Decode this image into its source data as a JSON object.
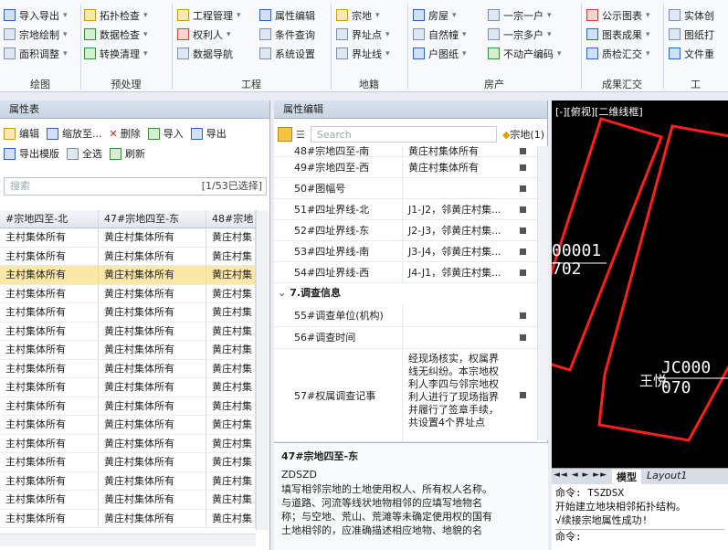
{
  "ribbon": {
    "col1": [
      "导入导出",
      "宗地绘制",
      "面积调整"
    ],
    "col2": [
      "拓扑检查",
      "数据检查",
      "转换清理"
    ],
    "col3": [
      "工程管理",
      "权利人",
      "数据导航"
    ],
    "col4": [
      "属性编辑",
      "条件查询",
      "系统设置"
    ],
    "col5": [
      "宗地",
      "界址点",
      "界址线"
    ],
    "col6": [
      "房屋",
      "自然幢",
      "户图纸"
    ],
    "col7": [
      "一宗一户",
      "一宗多户",
      "不动产编码"
    ],
    "col8": [
      "公示图表",
      "图表成果",
      "质检汇交"
    ],
    "col9": [
      "实体创",
      "图纸打",
      "文件重"
    ],
    "groups": [
      "绘图",
      "预处理",
      "工程",
      "地籍",
      "房产",
      "成果汇交",
      "工"
    ]
  },
  "attr_table": {
    "title": "属性表",
    "toolbar1": [
      "编辑",
      "缩放至...",
      "删除",
      "导入",
      "导出"
    ],
    "toolbar2": [
      "导出模版",
      "全选",
      "刷新"
    ],
    "search_placeholder": "搜索",
    "selection_count": "[1/53已选择]",
    "columns": [
      "#宗地四至-北",
      "47#宗地四至-东",
      "48#宗地"
    ],
    "rows": [
      [
        "主村集体所有",
        "黄庄村集体所有",
        "黄庄村集"
      ],
      [
        "主村集体所有",
        "黄庄村集体所有",
        "黄庄村集"
      ],
      [
        "主村集体所有",
        "黄庄村集体所有",
        "黄庄村集"
      ],
      [
        "主村集体所有",
        "黄庄村集体所有",
        "黄庄村集"
      ],
      [
        "主村集体所有",
        "黄庄村集体所有",
        "黄庄村集"
      ],
      [
        "主村集体所有",
        "黄庄村集体所有",
        "黄庄村集"
      ],
      [
        "主村集体所有",
        "黄庄村集体所有",
        "黄庄村集"
      ],
      [
        "主村集体所有",
        "黄庄村集体所有",
        "黄庄村集"
      ],
      [
        "主村集体所有",
        "黄庄村集体所有",
        "黄庄村集"
      ],
      [
        "主村集体所有",
        "黄庄村集体所有",
        "黄庄村集"
      ],
      [
        "主村集体所有",
        "黄庄村集体所有",
        "黄庄村集"
      ],
      [
        "主村集体所有",
        "黄庄村集体所有",
        "黄庄村集"
      ],
      [
        "主村集体所有",
        "黄庄村集体所有",
        "黄庄村集"
      ],
      [
        "主村集体所有",
        "黄庄村集体所有",
        "黄庄村集"
      ],
      [
        "主村集体所有",
        "黄庄村集体所有",
        "黄庄村集"
      ],
      [
        "主村集体所有",
        "黄庄村集体所有",
        "黄庄村集"
      ]
    ],
    "selected_row_index": 2
  },
  "attr_edit": {
    "title": "属性编辑",
    "search_placeholder": "Search",
    "layer": "宗地(1)",
    "props": [
      [
        "48#宗地四至-南",
        "黄庄村集体所有"
      ],
      [
        "49#宗地四至-西",
        "黄庄村集体所有"
      ],
      [
        "50#图幅号",
        ""
      ],
      [
        "51#四址界线-北",
        "J1-J2，邻黄庄村集..."
      ],
      [
        "52#四址界线-东",
        "J2-J3，邻黄庄村集..."
      ],
      [
        "53#四址界线-南",
        "J3-J4，邻黄庄村集..."
      ],
      [
        "54#四址界线-西",
        "J4-J1，邻黄庄村集..."
      ]
    ],
    "section": "7.调查信息",
    "props2": [
      [
        "55#调查单位(机构)",
        ""
      ],
      [
        "56#调查时间",
        ""
      ]
    ],
    "prop57_key": "57#权属调查记事",
    "prop57_lines": [
      "经现场核实，权属界",
      "线无纠纷。本宗地权",
      "利人李四与邻宗地权",
      "利人进行了现场指界",
      "并履行了签章手续，",
      "共设置4个界址点"
    ],
    "desc_title": "47#宗地四至-东",
    "desc_code": "ZDSZD",
    "desc_lines": [
      "填写相邻宗地的土地使用权人、所有权人名称。",
      "与道路、河流等线状地物相邻的应填写地物名",
      "称；与空地、荒山、荒滩等未确定使用权的国有",
      "土地相邻的，应准确描述相应地物、地貌的名"
    ]
  },
  "cad": {
    "view_label": "[-][俯视][二维线框]",
    "label1_line1": "00001",
    "label1_line2": "702",
    "owner_name": "王悦",
    "label2_line1": "JC000",
    "label2_line2": "070",
    "tab_model": "模型",
    "tab_layout": "Layout1",
    "cmd_lines": [
      "命令: TSZDSX",
      "开始建立地块相邻拓扑结构。",
      "√续接宗地属性成功!"
    ],
    "prompt": "命令:"
  }
}
